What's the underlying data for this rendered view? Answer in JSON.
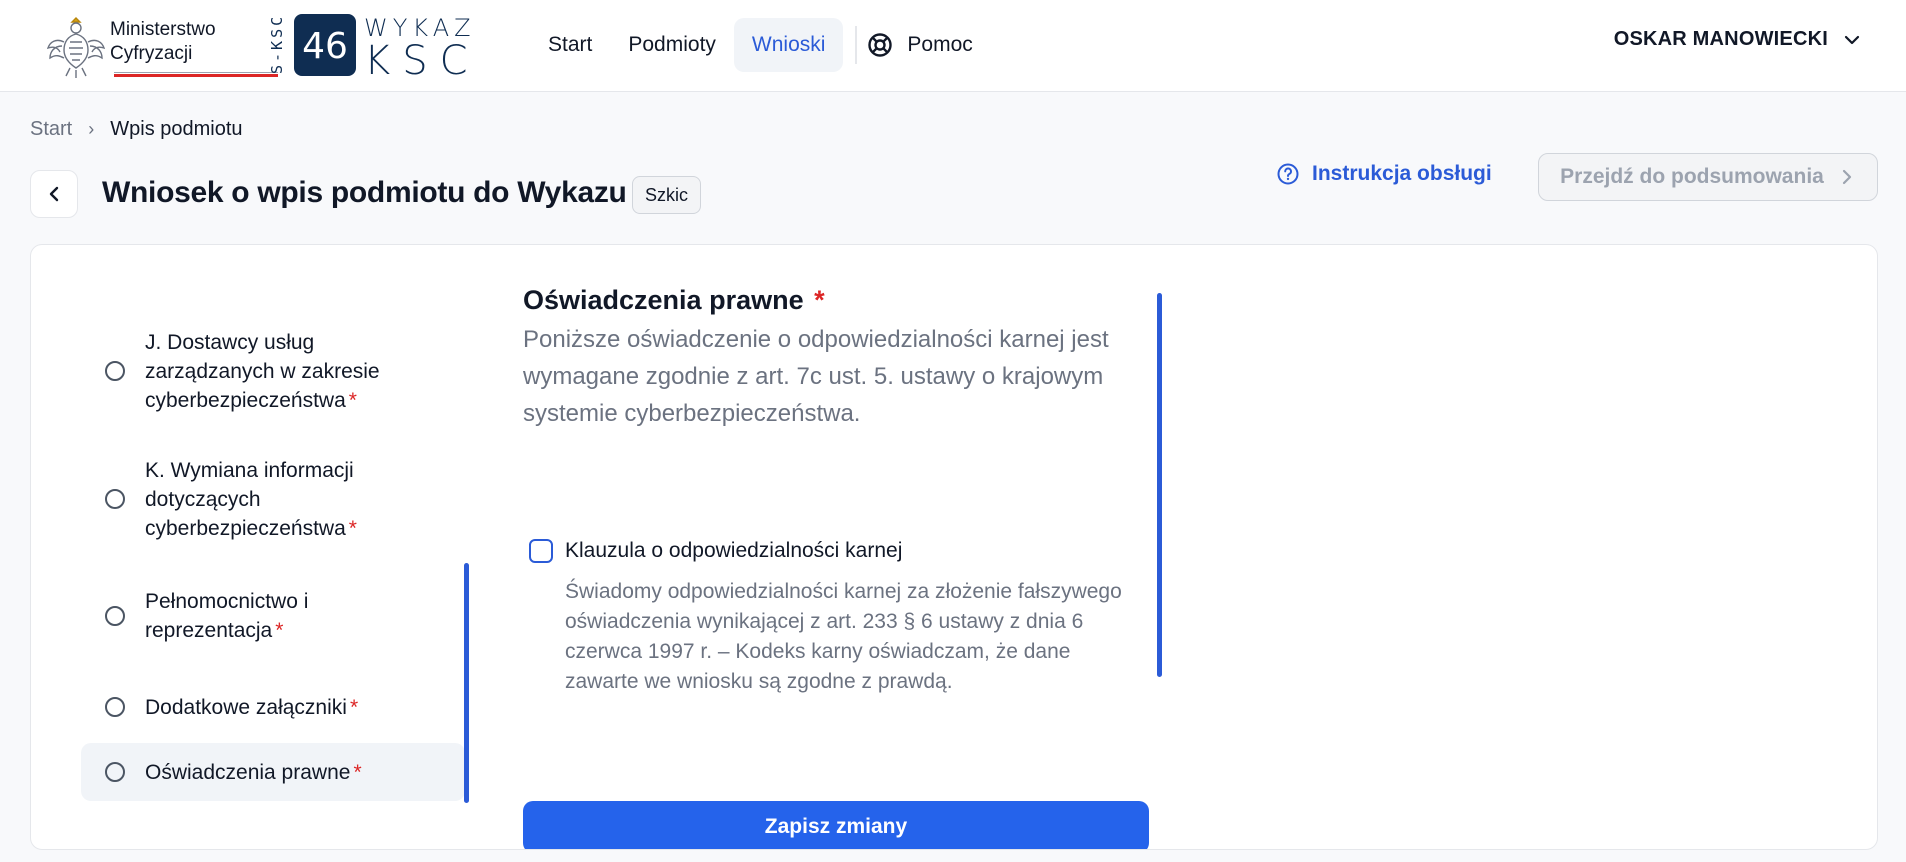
{
  "header": {
    "ministry_line1": "Ministerstwo",
    "ministry_line2": "Cyfryzacji",
    "ksc_top": "WYKAZ",
    "ksc_bottom": "KSC",
    "ksc_number": "46",
    "ksc_side": "S-KSC",
    "nav": [
      {
        "label": "Start"
      },
      {
        "label": "Podmioty"
      },
      {
        "label": "Wnioski"
      }
    ],
    "help_label": "Pomoc",
    "user_name": "OSKAR MANOWIECKI"
  },
  "breadcrumb": {
    "start": "Start",
    "separator": "›",
    "current": "Wpis podmiotu"
  },
  "page": {
    "title": "Wniosek o wpis podmiotu do Wykazu",
    "status": "Szkic",
    "manual_label": "Instrukcja obsługi",
    "summary_label": "Przejdź do podsumowania"
  },
  "steps": [
    {
      "label": "J. Dostawcy usług zarządzanych w zakresie cyberbezpieczeństwa",
      "required": "*"
    },
    {
      "label": "K. Wymiana informacji dotyczących cyberbezpieczeństwa",
      "required": "*"
    },
    {
      "label": "Pełnomocnictwo i reprezentacja",
      "required": "*"
    },
    {
      "label": "Dodatkowe załączniki",
      "required": "*"
    },
    {
      "label": "Oświadczenia prawne",
      "required": "*"
    }
  ],
  "section": {
    "title": "Oświadczenia prawne",
    "required": "*",
    "description": "Poniższe oświadczenie o odpowiedzialności karnej jest wymagane zgodnie z art. 7c ust. 5. ustawy o krajowym systemie cyberbezpieczeństwa.",
    "checkbox_label": "Klauzula o odpowiedzialności karnej",
    "clause_text": "Świadomy odpowiedzialności karnej za złożenie fałszywego oświadczenia wynikającej z art. 233 § 6 ustawy z dnia 6 czerwca 1997 r. – Kodeks karny oświadczam, że dane zawarte we wniosku są zgodne z prawdą.",
    "save_label": "Zapisz zmiany"
  },
  "colors": {
    "accent": "#2b5bd7",
    "primary_button": "#2563eb",
    "required": "#dc2626"
  },
  "icons": {
    "help": "lifebuoy-icon",
    "manual": "question-circle-icon",
    "back": "chevron-left-icon",
    "user_menu": "chevron-down-icon"
  }
}
